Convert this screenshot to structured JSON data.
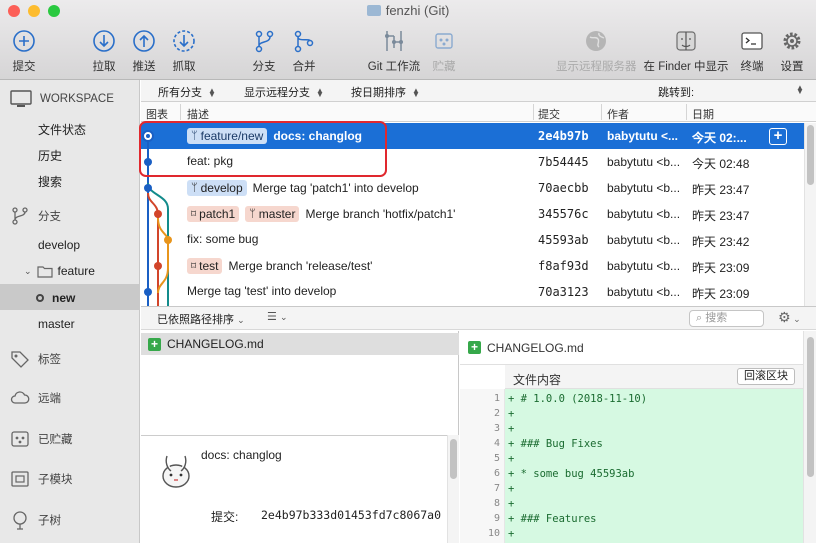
{
  "window": {
    "title": "fenzhi (Git)"
  },
  "toolbar": {
    "commit": "提交",
    "pull": "拉取",
    "push": "推送",
    "fetch": "抓取",
    "branch": "分支",
    "merge": "合并",
    "gitflow": "Git 工作流",
    "stash": "贮藏",
    "show_remote": "显示远程服务器",
    "show_finder": "在 Finder 中显示",
    "terminal": "终端",
    "settings": "设置"
  },
  "sidebar": {
    "workspace": "WORKSPACE",
    "workspace_items": [
      "文件状态",
      "历史",
      "搜索"
    ],
    "branches_header": "分支",
    "branches": [
      "develop",
      "feature",
      "new",
      "master"
    ],
    "tags": "标签",
    "remotes": "远端",
    "stashes": "已贮藏",
    "submodules": "子模块",
    "subtrees": "子树"
  },
  "filter": {
    "branches": "所有分支",
    "remote": "显示远程分支",
    "sort": "按日期排序",
    "jump": "跳转到:"
  },
  "columns": {
    "graph": "图表",
    "desc": "描述",
    "commit": "提交",
    "author": "作者",
    "date": "日期"
  },
  "commits": [
    {
      "branch": "feature/new",
      "message": "docs: changlog",
      "hash": "2e4b97b",
      "author": "babytutu <...",
      "date": "今天 02:..."
    },
    {
      "message": "feat: pkg",
      "hash": "7b54445",
      "author": "babytutu <b...",
      "date": "今天 02:48"
    },
    {
      "branch": "develop",
      "message": "Merge tag 'patch1' into develop",
      "hash": "70aecbb",
      "author": "babytutu <b...",
      "date": "昨天 23:47"
    },
    {
      "tag": "patch1",
      "branch": "master",
      "message": "Merge branch 'hotfix/patch1'",
      "hash": "345576c",
      "author": "babytutu <b...",
      "date": "昨天 23:47"
    },
    {
      "message": "fix: some bug",
      "hash": "45593ab",
      "author": "babytutu <b...",
      "date": "昨天 23:42"
    },
    {
      "tag": "test",
      "message": "Merge branch 'release/test'",
      "hash": "f8af93d",
      "author": "babytutu <b...",
      "date": "昨天 23:09"
    },
    {
      "message": "Merge tag 'test' into develop",
      "hash": "70a3123",
      "author": "babytutu <b...",
      "date": "昨天 23:09"
    }
  ],
  "bottombar": {
    "sort": "已依照路径排序",
    "search_placeholder": "搜索"
  },
  "files": {
    "name": "CHANGELOG.md"
  },
  "commit_info": {
    "message": "docs: changlog",
    "label": "提交:",
    "hash": "2e4b97b333d01453fd7c8067a0"
  },
  "diff": {
    "file": "CHANGELOG.md",
    "hunk_label": "文件内容",
    "rollback": "回滚区块",
    "lines": [
      {
        "n": "1",
        "t": "+ # 1.0.0 (2018-11-10)"
      },
      {
        "n": "2",
        "t": "+"
      },
      {
        "n": "3",
        "t": "+"
      },
      {
        "n": "4",
        "t": "+ ### Bug Fixes"
      },
      {
        "n": "5",
        "t": "+"
      },
      {
        "n": "6",
        "t": "+ * some bug 45593ab"
      },
      {
        "n": "7",
        "t": "+"
      },
      {
        "n": "8",
        "t": "+"
      },
      {
        "n": "9",
        "t": "+ ### Features"
      },
      {
        "n": "10",
        "t": "+"
      }
    ]
  },
  "colors": {
    "selection": "#1b6fd6",
    "graph_blue": "#1a5fc4",
    "graph_orange": "#e8951c",
    "graph_red": "#d2452a",
    "graph_teal": "#138b8b",
    "highlight": "#e0282e"
  }
}
